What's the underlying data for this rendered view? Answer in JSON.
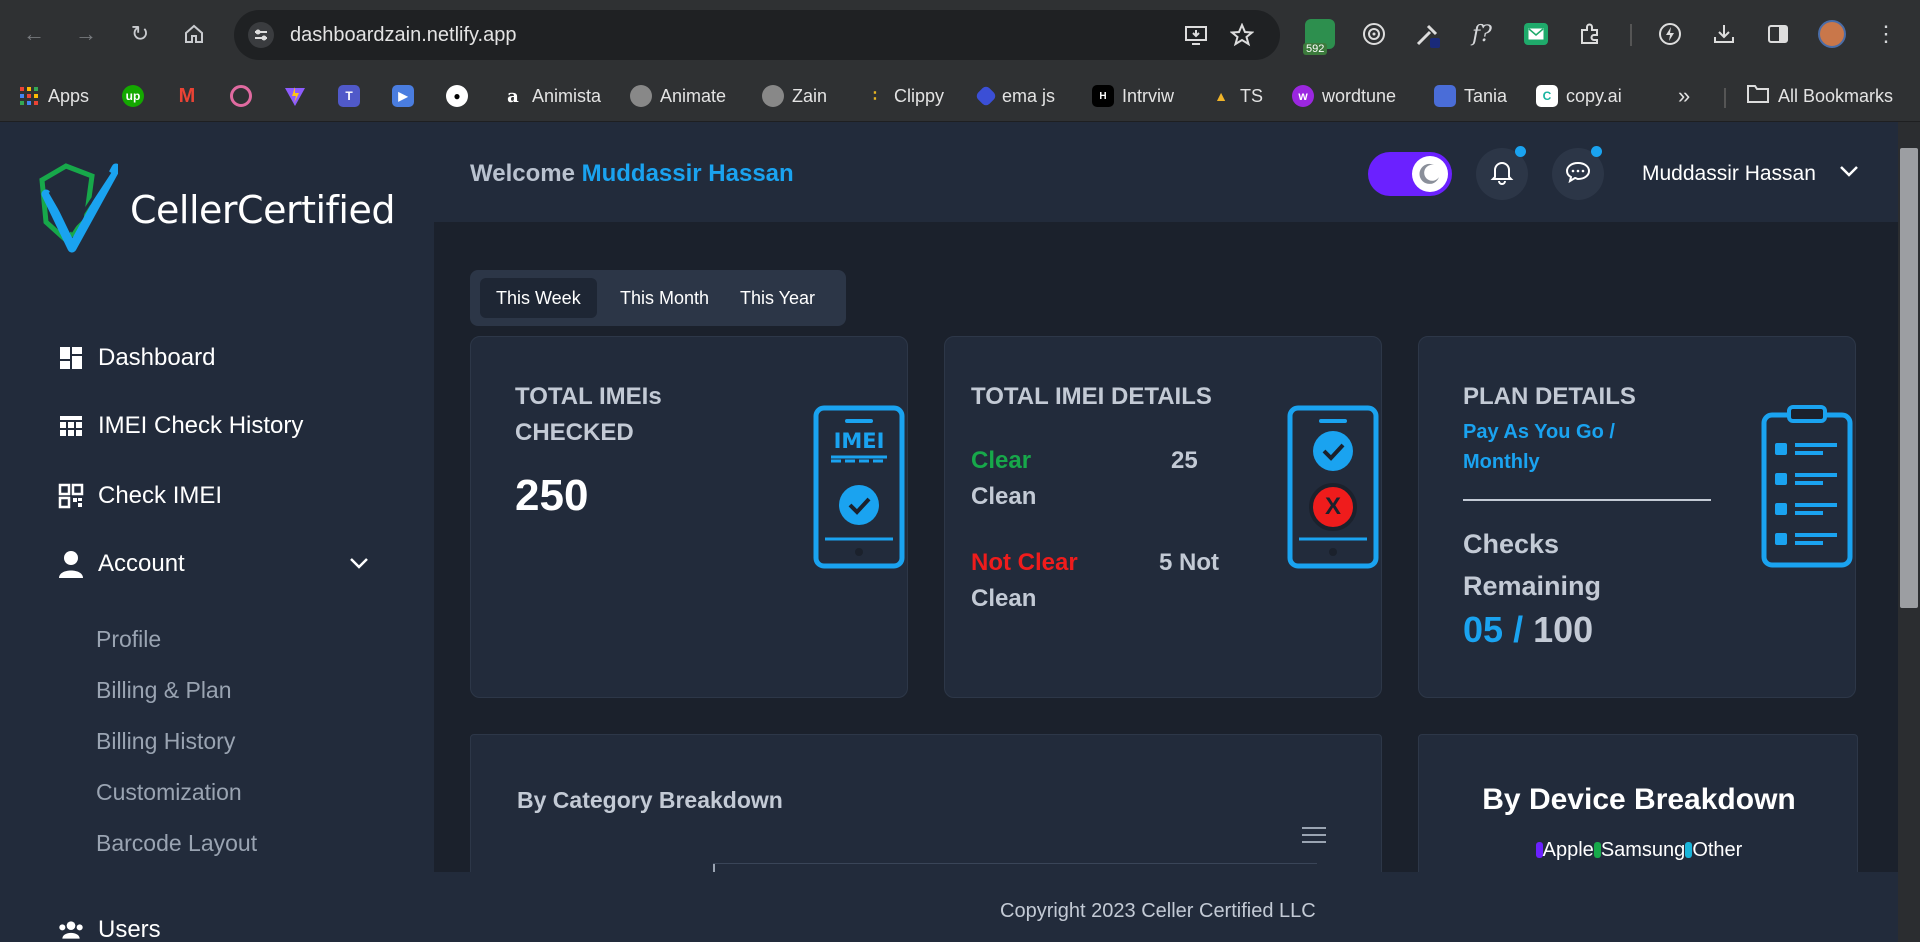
{
  "browser": {
    "url": "dashboardzain.netlify.app",
    "extension_badge": "592",
    "bookmarks": [
      {
        "label": "Apps",
        "icon": "apps-grid-icon"
      },
      {
        "label": "",
        "icon": "upwork-icon"
      },
      {
        "label": "",
        "icon": "gmail-icon"
      },
      {
        "label": "",
        "icon": "ring-icon"
      },
      {
        "label": "",
        "icon": "vite-icon"
      },
      {
        "label": "",
        "icon": "teams-icon"
      },
      {
        "label": "",
        "icon": "media-icon"
      },
      {
        "label": "",
        "icon": "github-icon"
      },
      {
        "label": "Animista",
        "icon": "animista-icon"
      },
      {
        "label": "Animate",
        "icon": "globe-icon"
      },
      {
        "label": "Zain",
        "icon": "globe-icon"
      },
      {
        "label": "Clippy",
        "icon": "clippy-icon"
      },
      {
        "label": "ema js",
        "icon": "emailjs-icon"
      },
      {
        "label": "Intrviw",
        "icon": "intrviw-icon"
      },
      {
        "label": "TS",
        "icon": "ts-icon"
      },
      {
        "label": "wordtune",
        "icon": "wordtune-icon"
      },
      {
        "label": "Tania",
        "icon": "save-icon"
      },
      {
        "label": "copy.ai",
        "icon": "copyai-icon"
      }
    ],
    "more": "»",
    "all_bookmarks": "All Bookmarks"
  },
  "brand": {
    "name": "CellerCertified"
  },
  "sidebar": {
    "items": [
      {
        "label": "Dashboard"
      },
      {
        "label": "IMEI Check History"
      },
      {
        "label": "Check IMEI"
      },
      {
        "label": "Account"
      }
    ],
    "account_sub": [
      "Profile",
      "Billing & Plan",
      "Billing History",
      "Customization",
      "Barcode Layout"
    ],
    "users": "Users"
  },
  "header": {
    "welcome": "Welcome",
    "name": "Muddassir Hassan",
    "user": "Muddassir Hassan"
  },
  "tabs": [
    "This Week",
    "This Month",
    "This Year"
  ],
  "cards": {
    "total_checked": {
      "title_line1": "TOTAL IMEIs",
      "title_line2": "CHECKED",
      "value": "250",
      "icon_text": "IMEI"
    },
    "details": {
      "title": "TOTAL IMEI DETAILS",
      "clear_label": "Clear",
      "clear_value": "25",
      "clean": "Clean",
      "not_clear_label": "Not Clear",
      "not_clear_value": "5 Not",
      "not_clean": "Clean",
      "x_mark": "X"
    },
    "plan": {
      "title": "PLAN DETAILS",
      "plan_line1": "Pay As You Go /",
      "plan_line2": "Monthly",
      "checks_line1": "Checks",
      "checks_line2": "Remaining",
      "used": "05",
      "sep": "/",
      "total": "100"
    }
  },
  "category": {
    "title": "By Category Breakdown"
  },
  "device": {
    "title": "By Device Breakdown",
    "legend": [
      {
        "label": "Apple",
        "color": "#6b21ff"
      },
      {
        "label": "Samsung",
        "color": "#17a84a"
      },
      {
        "label": "Other",
        "color": "#19b4d9"
      }
    ]
  },
  "footer": {
    "copyright": "Copyright 2023 Celler Certified LLC"
  },
  "colors": {
    "accent": "#1aa3f0",
    "toggle": "#6b21ff",
    "clear": "#17a84a",
    "not_clear": "#ef1c1c"
  }
}
